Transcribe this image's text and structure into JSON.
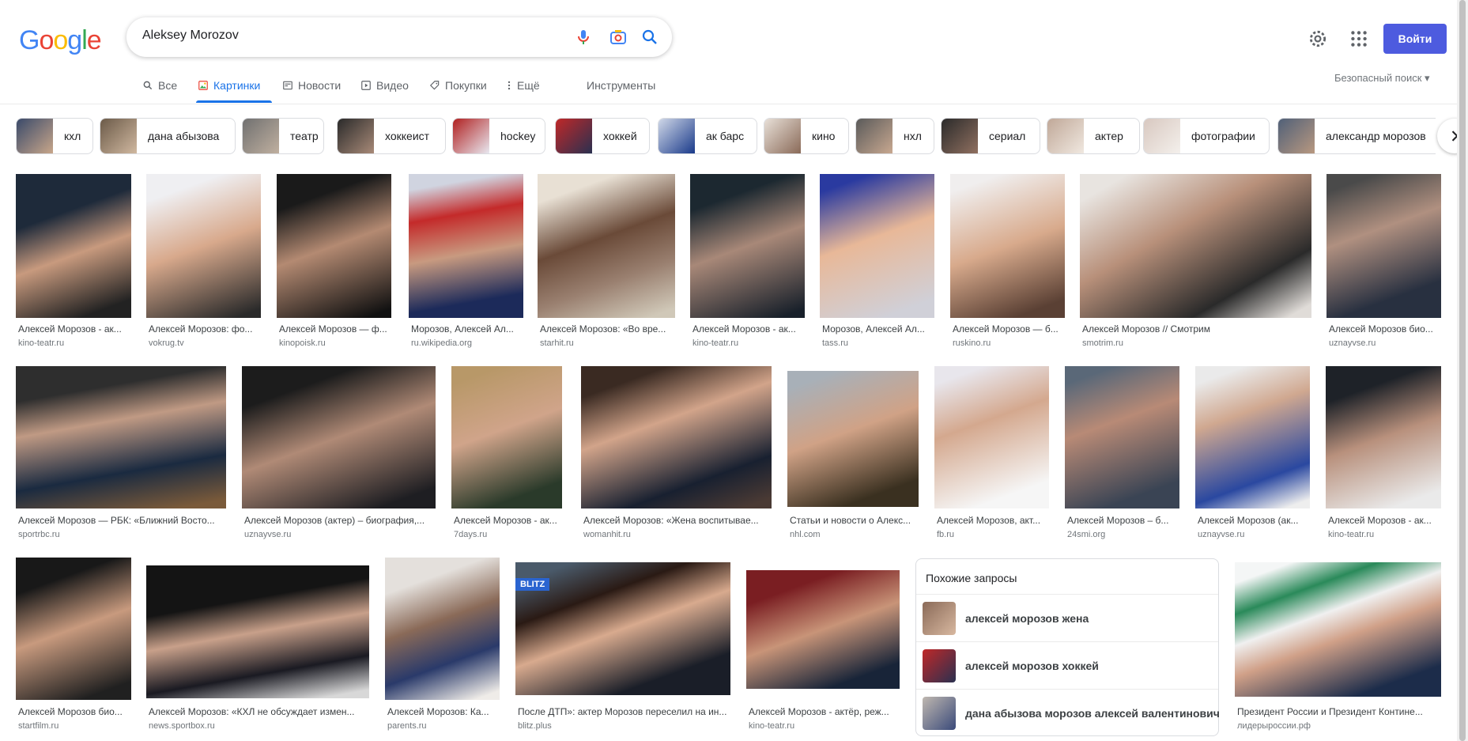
{
  "logo": "Google",
  "search": {
    "query": "Aleksey Morozov"
  },
  "header": {
    "login_label": "Войти"
  },
  "tabs": [
    {
      "label": "Все",
      "icon": "search-icon"
    },
    {
      "label": "Картинки",
      "icon": "image-icon",
      "active": true
    },
    {
      "label": "Новости",
      "icon": "news-icon"
    },
    {
      "label": "Видео",
      "icon": "video-icon"
    },
    {
      "label": "Покупки",
      "icon": "tag-icon"
    },
    {
      "label": "Ещё",
      "icon": "more-vert-icon"
    }
  ],
  "tools_label": "Инструменты",
  "safesearch_label": "Безопасный поиск",
  "chips": [
    "кхл",
    "дана абызова",
    "театр",
    "хоккеист",
    "hockey",
    "хоккей",
    "ак барс",
    "кино",
    "нхл",
    "сериал",
    "актер",
    "фотографии",
    "александр морозов"
  ],
  "images_row1": [
    {
      "title": "Алексей Морозов - ак...",
      "source": "kino-teatr.ru"
    },
    {
      "title": "Алексей Морозов: фо...",
      "source": "vokrug.tv"
    },
    {
      "title": "Алексей Морозов — ф...",
      "source": "kinopoisk.ru"
    },
    {
      "title": "Морозов, Алексей Ал...",
      "source": "ru.wikipedia.org"
    },
    {
      "title": "Алексей Морозов: «Во вре...",
      "source": "starhit.ru"
    },
    {
      "title": "Алексей Морозов - ак...",
      "source": "kino-teatr.ru"
    },
    {
      "title": "Морозов, Алексей Ал...",
      "source": "tass.ru"
    },
    {
      "title": "Алексей Морозов — б...",
      "source": "ruskino.ru"
    },
    {
      "title": "Алексей Морозов // Смотрим",
      "source": "smotrim.ru"
    },
    {
      "title": "Алексей Морозов био...",
      "source": "uznayvse.ru"
    }
  ],
  "images_row2": [
    {
      "title": "Алексей Морозов — РБК: «Ближний Восто...",
      "source": "sportrbc.ru"
    },
    {
      "title": "Алексей Морозов (актер) – биография,...",
      "source": "uznayvse.ru"
    },
    {
      "title": "Алексей Морозов - ак...",
      "source": "7days.ru"
    },
    {
      "title": "Алексей Морозов: «Жена воспитывае...",
      "source": "womanhit.ru"
    },
    {
      "title": "Статьи и новости о Алекс...",
      "source": "nhl.com"
    },
    {
      "title": "Алексей Морозов, акт...",
      "source": "fb.ru"
    },
    {
      "title": "Алексей Морозов – б...",
      "source": "24smi.org"
    },
    {
      "title": "Алексей Морозов (ак...",
      "source": "uznayvse.ru"
    },
    {
      "title": "Алексей Морозов - ак...",
      "source": "kino-teatr.ru"
    }
  ],
  "images_row3": [
    {
      "title": "Алексей Морозов био...",
      "source": "startfilm.ru"
    },
    {
      "title": "Алексей Морозов: «КХЛ не обсуждает измен...",
      "source": "news.sportbox.ru"
    },
    {
      "title": "Алексей Морозов: Ка...",
      "source": "parents.ru"
    },
    {
      "title": "После ДТП»: актер Морозов переселил на ин...",
      "source": "blitz.plus"
    },
    {
      "title": "Алексей Морозов - актёр, реж...",
      "source": "kino-teatr.ru"
    },
    {
      "title": "Президент России и Президент Контине...",
      "source": "лидерыроссии.рф"
    }
  ],
  "related": {
    "title": "Похожие запросы",
    "items": [
      "алексей морозов жена",
      "алексей морозов хоккей",
      "дана абызова морозов алексей валентинович"
    ]
  }
}
